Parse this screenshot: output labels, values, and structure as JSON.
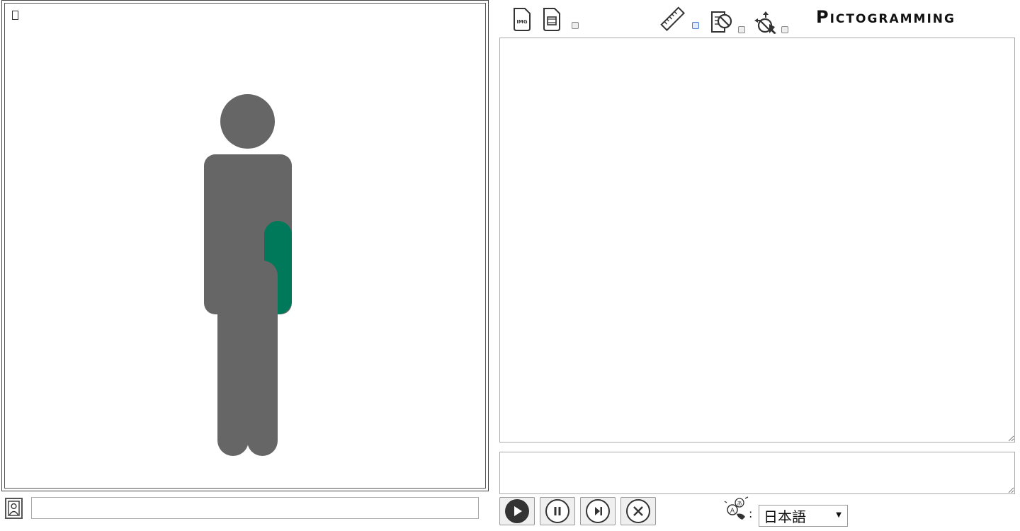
{
  "app": {
    "title": "Pictogramming"
  },
  "canvas": {
    "figure": {
      "body_color": "#666666",
      "highlight_color": "#00785a"
    }
  },
  "toolbar": {
    "icons": [
      "image-export-icon",
      "movie-export-icon",
      "ruler-icon",
      "hide-code-icon",
      "move-tool-icon"
    ],
    "checkboxes": {
      "movie": false,
      "ruler": false,
      "hide": false,
      "move": false
    }
  },
  "bottom_left": {
    "input_value": "",
    "avatar_icon": "avatar-icon"
  },
  "editor": {
    "code": "",
    "console": ""
  },
  "controls": {
    "buttons": [
      "play-icon",
      "pause-icon",
      "step-icon",
      "stop-icon"
    ]
  },
  "language": {
    "selected": "日本語"
  }
}
